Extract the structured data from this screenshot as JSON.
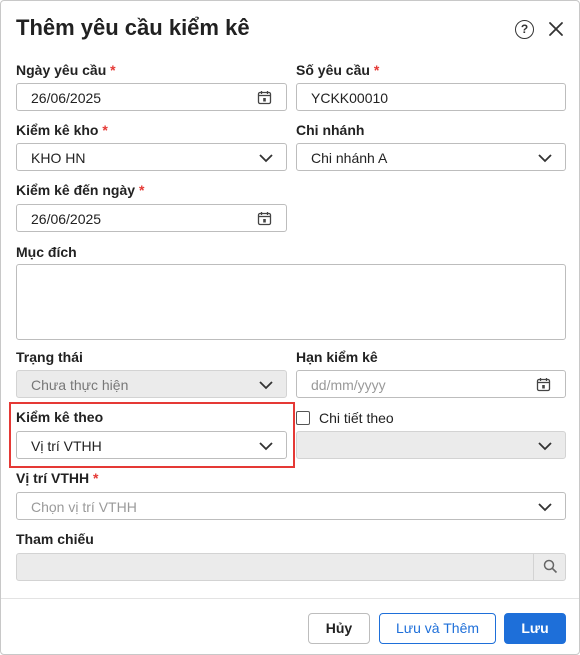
{
  "dialog": {
    "title": "Thêm yêu cầu kiểm kê",
    "help_label": "?"
  },
  "form": {
    "request_date": {
      "label": "Ngày yêu cầu",
      "required": "*",
      "value": "26/06/2025"
    },
    "request_number": {
      "label": "Số yêu cầu",
      "required": "*",
      "value": "YCKK00010"
    },
    "warehouse": {
      "label": "Kiểm kê kho",
      "required": "*",
      "value": "KHO HN"
    },
    "branch": {
      "label": "Chi nhánh",
      "value": "Chi nhánh A"
    },
    "inventory_to_date": {
      "label": "Kiểm kê đến ngày",
      "required": "*",
      "value": "26/06/2025"
    },
    "purpose": {
      "label": "Mục đích",
      "value": ""
    },
    "status": {
      "label": "Trạng thái",
      "value": "Chưa thực hiện"
    },
    "deadline": {
      "label": "Hạn kiểm kê",
      "placeholder": "dd/mm/yyyy"
    },
    "inventory_by": {
      "label": "Kiểm kê theo",
      "value": "Vị trí VTHH"
    },
    "detail_by": {
      "label": "Chi tiết theo",
      "checked": false,
      "value": ""
    },
    "location": {
      "label": "Vị trí VTHH",
      "required": "*",
      "placeholder": "Chọn vị trí VTHH"
    },
    "reference": {
      "label": "Tham chiếu",
      "value": ""
    }
  },
  "footer": {
    "cancel_label": "Hủy",
    "save_add_label": "Lưu và Thêm",
    "save_label": "Lưu"
  },
  "colors": {
    "accent": "#1e6fd9",
    "required": "#e53935",
    "highlight": "#e53935"
  }
}
